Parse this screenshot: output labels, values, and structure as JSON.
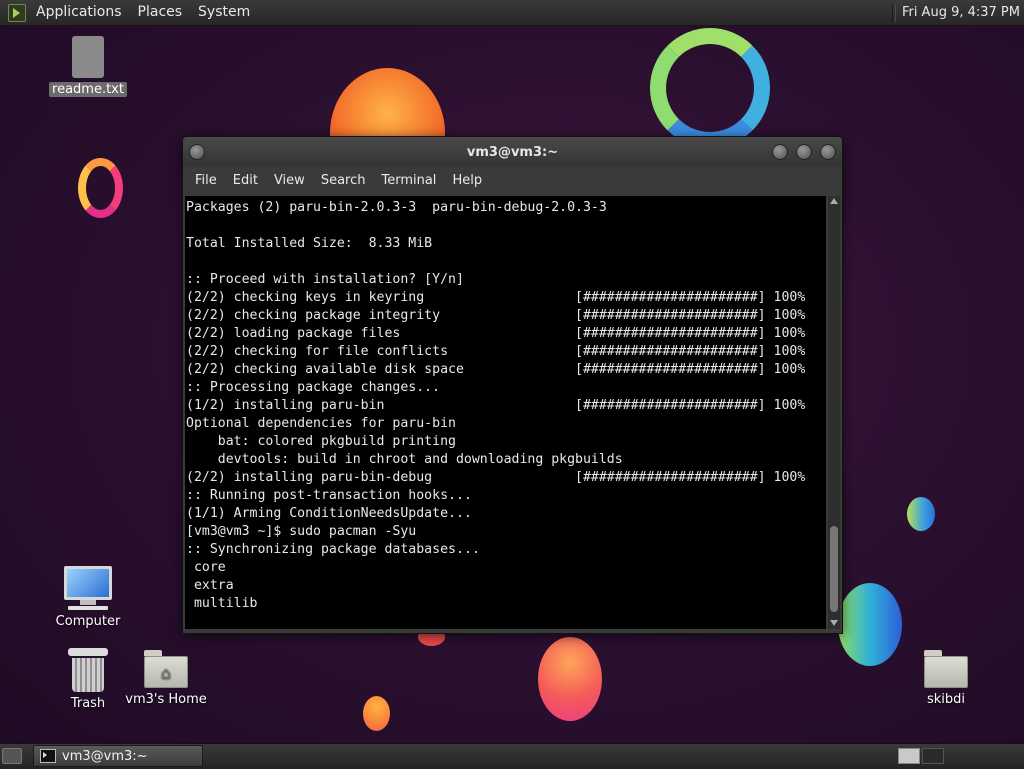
{
  "top_panel": {
    "menus": [
      "Applications",
      "Places",
      "System"
    ],
    "clock": "Fri Aug  9,  4:37 PM"
  },
  "desktop": {
    "icons": {
      "readme": "readme.txt",
      "computer": "Computer",
      "trash": "Trash",
      "home": "vm3's Home",
      "skibdi": "skibdi"
    }
  },
  "terminal": {
    "title": "vm3@vm3:~",
    "menus": [
      "File",
      "Edit",
      "View",
      "Search",
      "Terminal",
      "Help"
    ],
    "output": "Packages (2) paru-bin-2.0.3-3  paru-bin-debug-2.0.3-3\n\nTotal Installed Size:  8.33 MiB\n\n:: Proceed with installation? [Y/n]\n(2/2) checking keys in keyring                   [######################] 100%\n(2/2) checking package integrity                 [######################] 100%\n(2/2) loading package files                      [######################] 100%\n(2/2) checking for file conflicts                [######################] 100%\n(2/2) checking available disk space              [######################] 100%\n:: Processing package changes...\n(1/2) installing paru-bin                        [######################] 100%\nOptional dependencies for paru-bin\n    bat: colored pkgbuild printing\n    devtools: build in chroot and downloading pkgbuilds\n(2/2) installing paru-bin-debug                  [######################] 100%\n:: Running post-transaction hooks...\n(1/1) Arming ConditionNeedsUpdate...\n[vm3@vm3 ~]$ sudo pacman -Syu\n:: Synchronizing package databases...\n core\n extra\n multilib"
  },
  "taskbar": {
    "task_label": "vm3@vm3:~"
  }
}
